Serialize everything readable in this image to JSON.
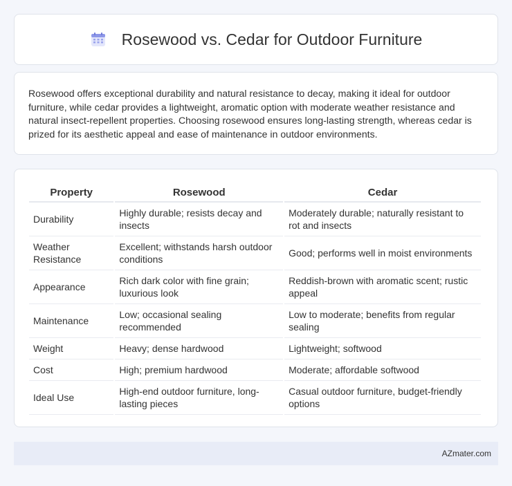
{
  "header": {
    "title": "Rosewood vs. Cedar for Outdoor Furniture",
    "icon": "calendar-icon"
  },
  "intro": {
    "text": "Rosewood offers exceptional durability and natural resistance to decay, making it ideal for outdoor furniture, while cedar provides a lightweight, aromatic option with moderate weather resistance and natural insect-repellent properties. Choosing rosewood ensures long-lasting strength, whereas cedar is prized for its aesthetic appeal and ease of maintenance in outdoor environments."
  },
  "table": {
    "headers": [
      "Property",
      "Rosewood",
      "Cedar"
    ],
    "rows": [
      [
        "Durability",
        "Highly durable; resists decay and insects",
        "Moderately durable; naturally resistant to rot and insects"
      ],
      [
        "Weather Resistance",
        "Excellent; withstands harsh outdoor conditions",
        "Good; performs well in moist environments"
      ],
      [
        "Appearance",
        "Rich dark color with fine grain; luxurious look",
        "Reddish-brown with aromatic scent; rustic appeal"
      ],
      [
        "Maintenance",
        "Low; occasional sealing recommended",
        "Low to moderate; benefits from regular sealing"
      ],
      [
        "Weight",
        "Heavy; dense hardwood",
        "Lightweight; softwood"
      ],
      [
        "Cost",
        "High; premium hardwood",
        "Moderate; affordable softwood"
      ],
      [
        "Ideal Use",
        "High-end outdoor furniture, long-lasting pieces",
        "Casual outdoor furniture, budget-friendly options"
      ]
    ]
  },
  "footer": {
    "site": "AZmater.com"
  }
}
